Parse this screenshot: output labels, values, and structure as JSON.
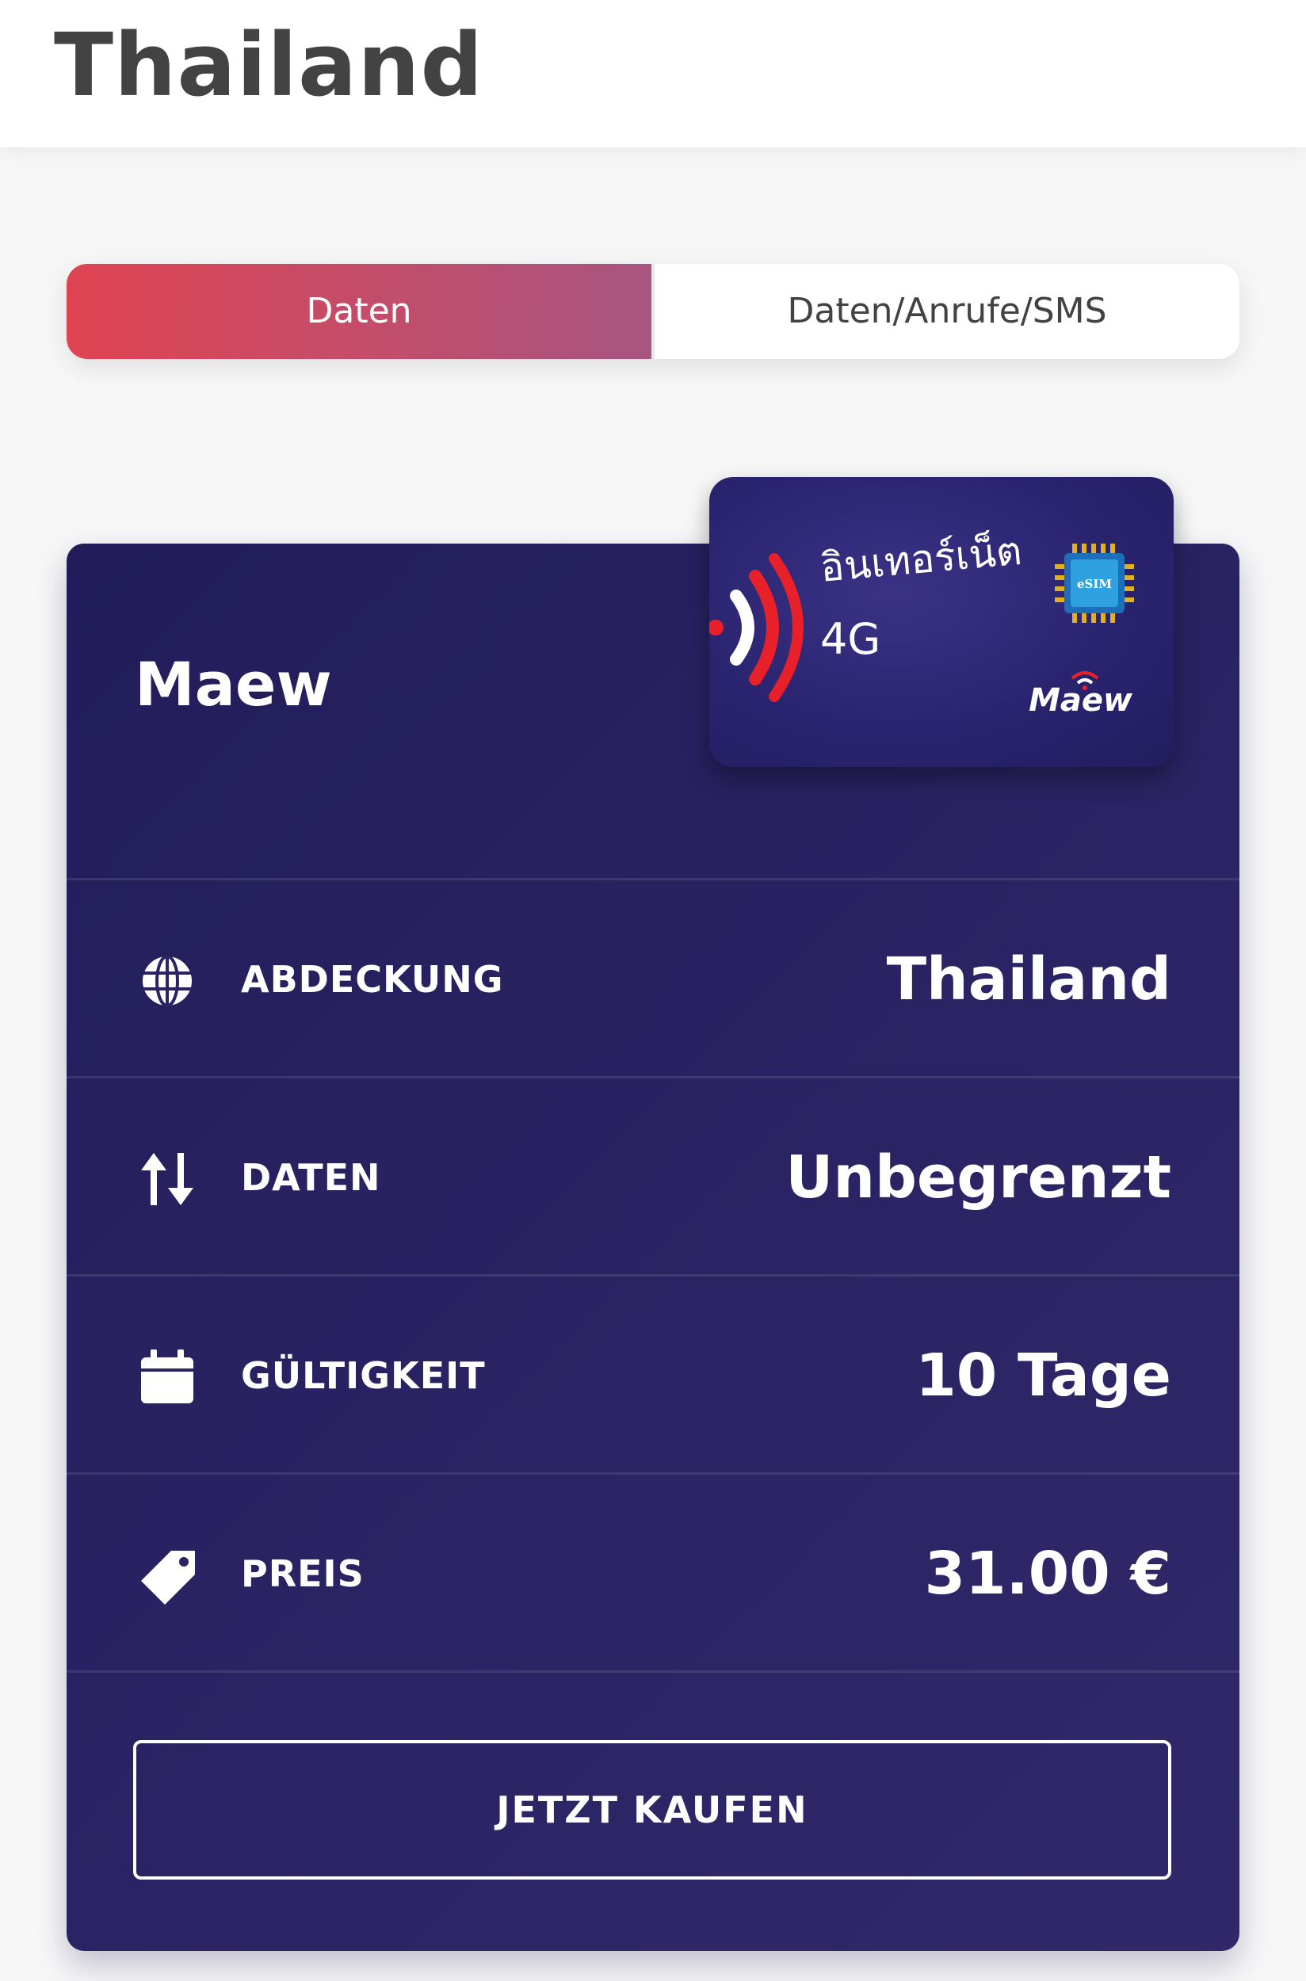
{
  "header": {
    "title": "Thailand"
  },
  "tabs": [
    {
      "label": "Daten",
      "active": true
    },
    {
      "label": "Daten/Anrufe/SMS",
      "active": false
    }
  ],
  "plan": {
    "provider_name": "Maew",
    "sim_card": {
      "title_thai": "อินเทอร์เน็ต",
      "subtitle": "4G",
      "chip_label": "eSIM",
      "brand": "Maew"
    },
    "rows": [
      {
        "icon": "globe-icon",
        "label": "ABDECKUNG",
        "value": "Thailand"
      },
      {
        "icon": "data-transfer-icon",
        "label": "DATEN",
        "value": "Unbegrenzt"
      },
      {
        "icon": "calendar-icon",
        "label": "GÜLTIGKEIT",
        "value": "10 Tage"
      },
      {
        "icon": "price-tag-icon",
        "label": "PREIS",
        "value": "31.00 €"
      }
    ],
    "buy_button": "JETZT KAUFEN"
  },
  "colors": {
    "accent_gradient_start": "#e04452",
    "accent_gradient_end": "#a85580",
    "card_background": "#2a2464",
    "sim_waves": "#e8202a"
  }
}
